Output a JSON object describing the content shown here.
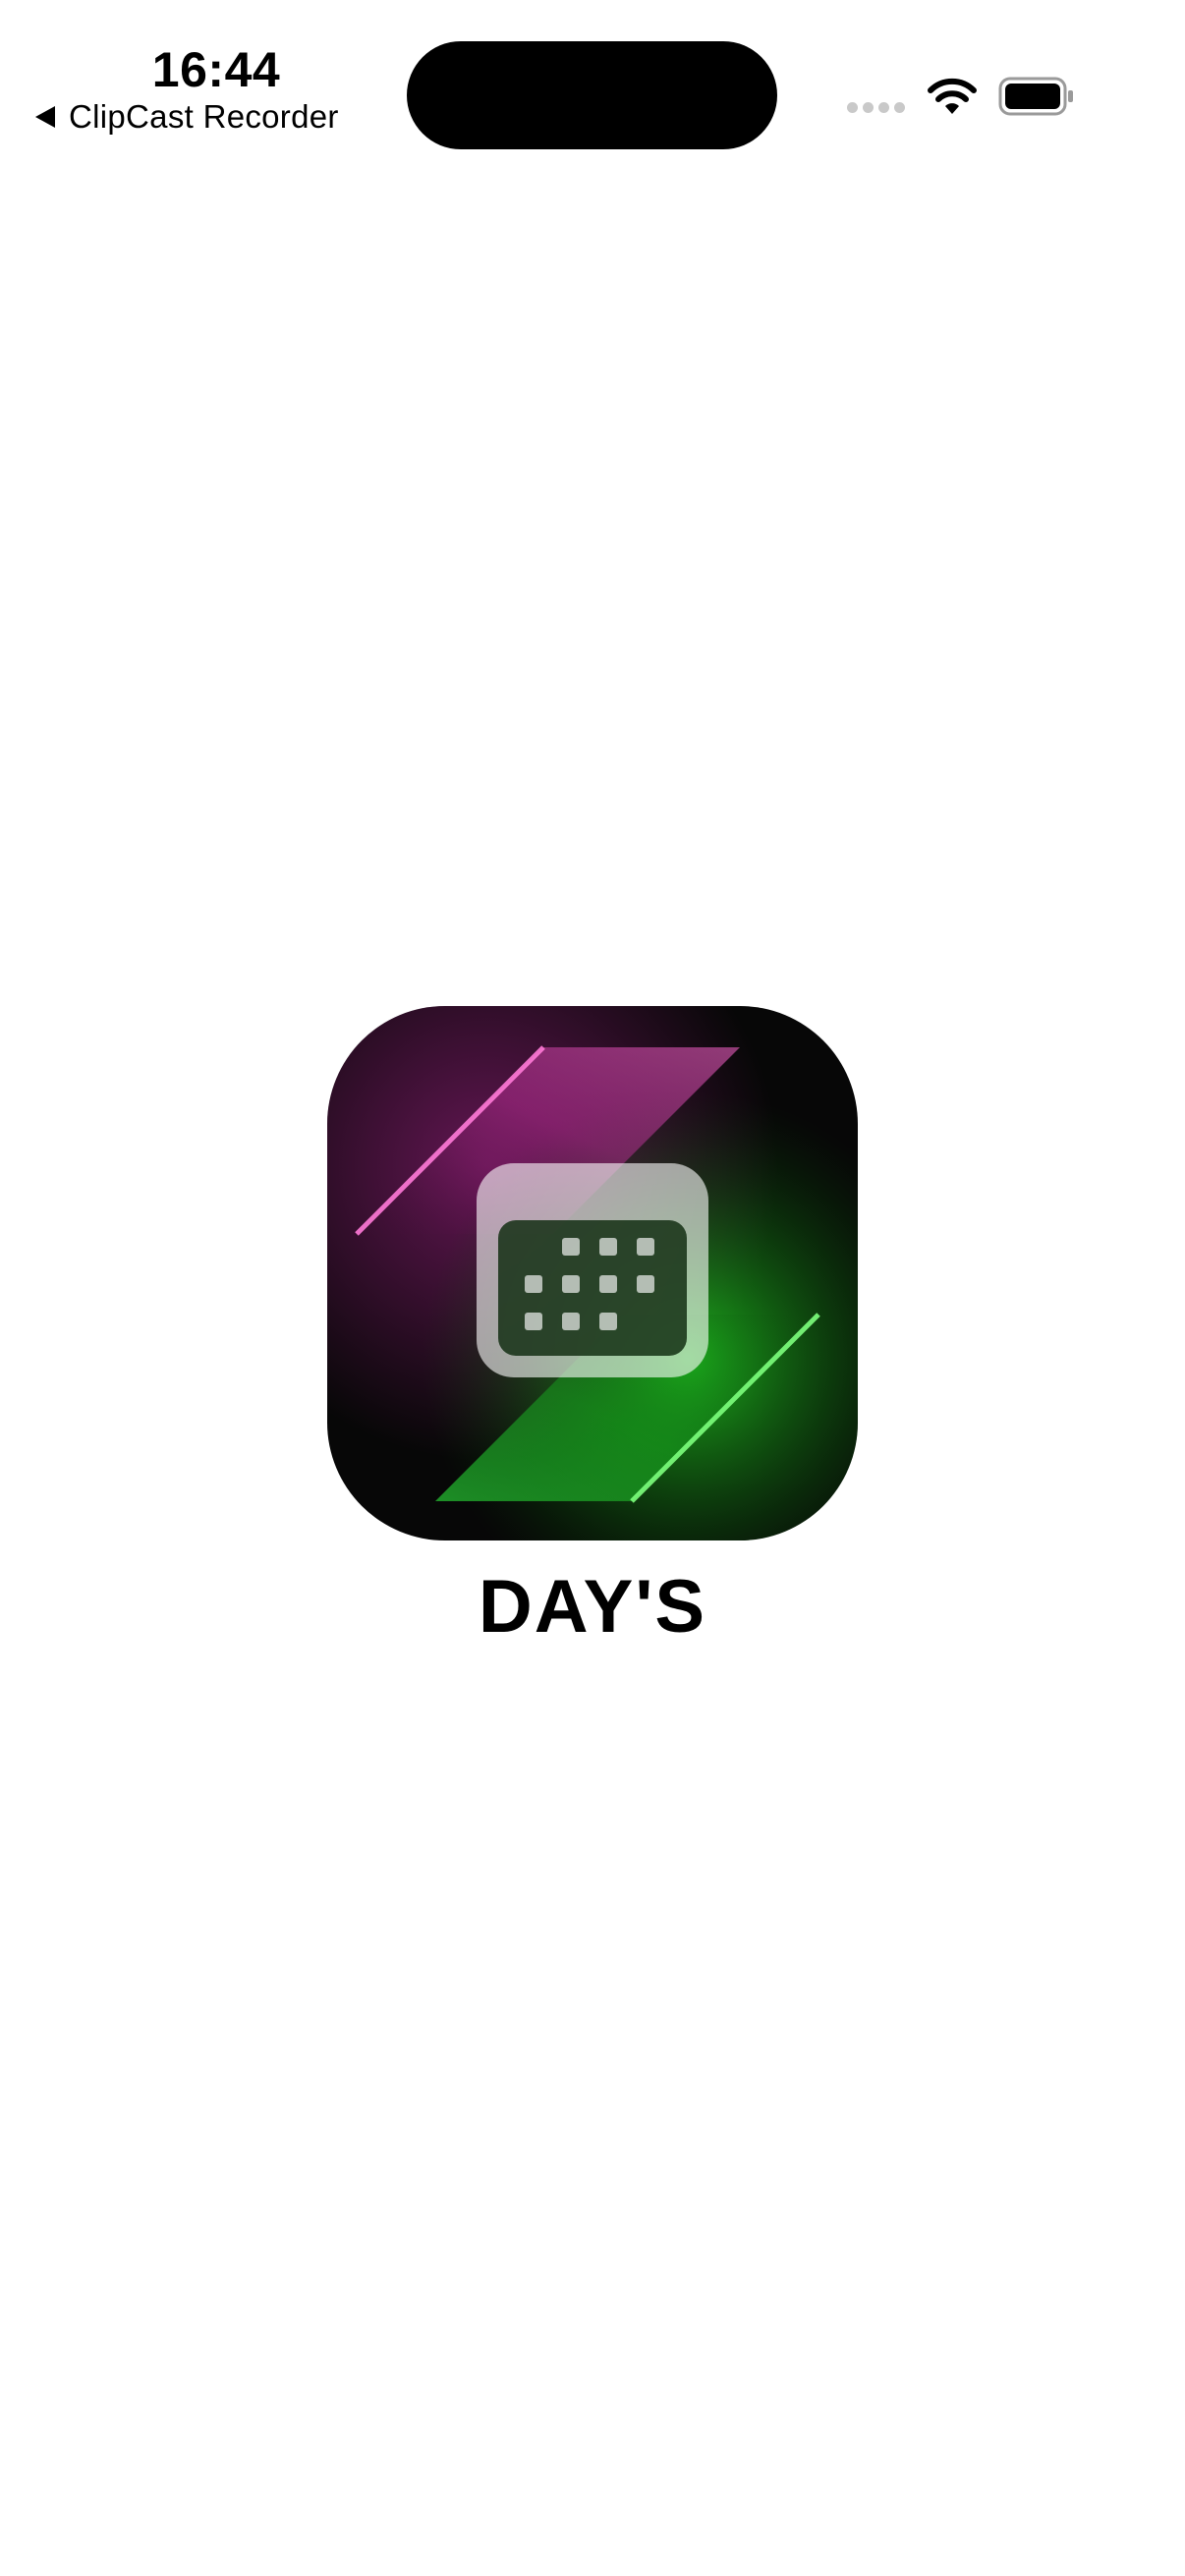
{
  "status_bar": {
    "time": "16:44",
    "back_app": "ClipCast Recorder",
    "icons": [
      "signal-dots-icon",
      "wifi-icon",
      "battery-icon"
    ]
  },
  "splash": {
    "app_icon": "calendar-icon",
    "title": "DAY'S"
  },
  "colors": {
    "background": "#ffffff",
    "accent_pink": "#e040b0",
    "accent_green": "#20d020"
  }
}
